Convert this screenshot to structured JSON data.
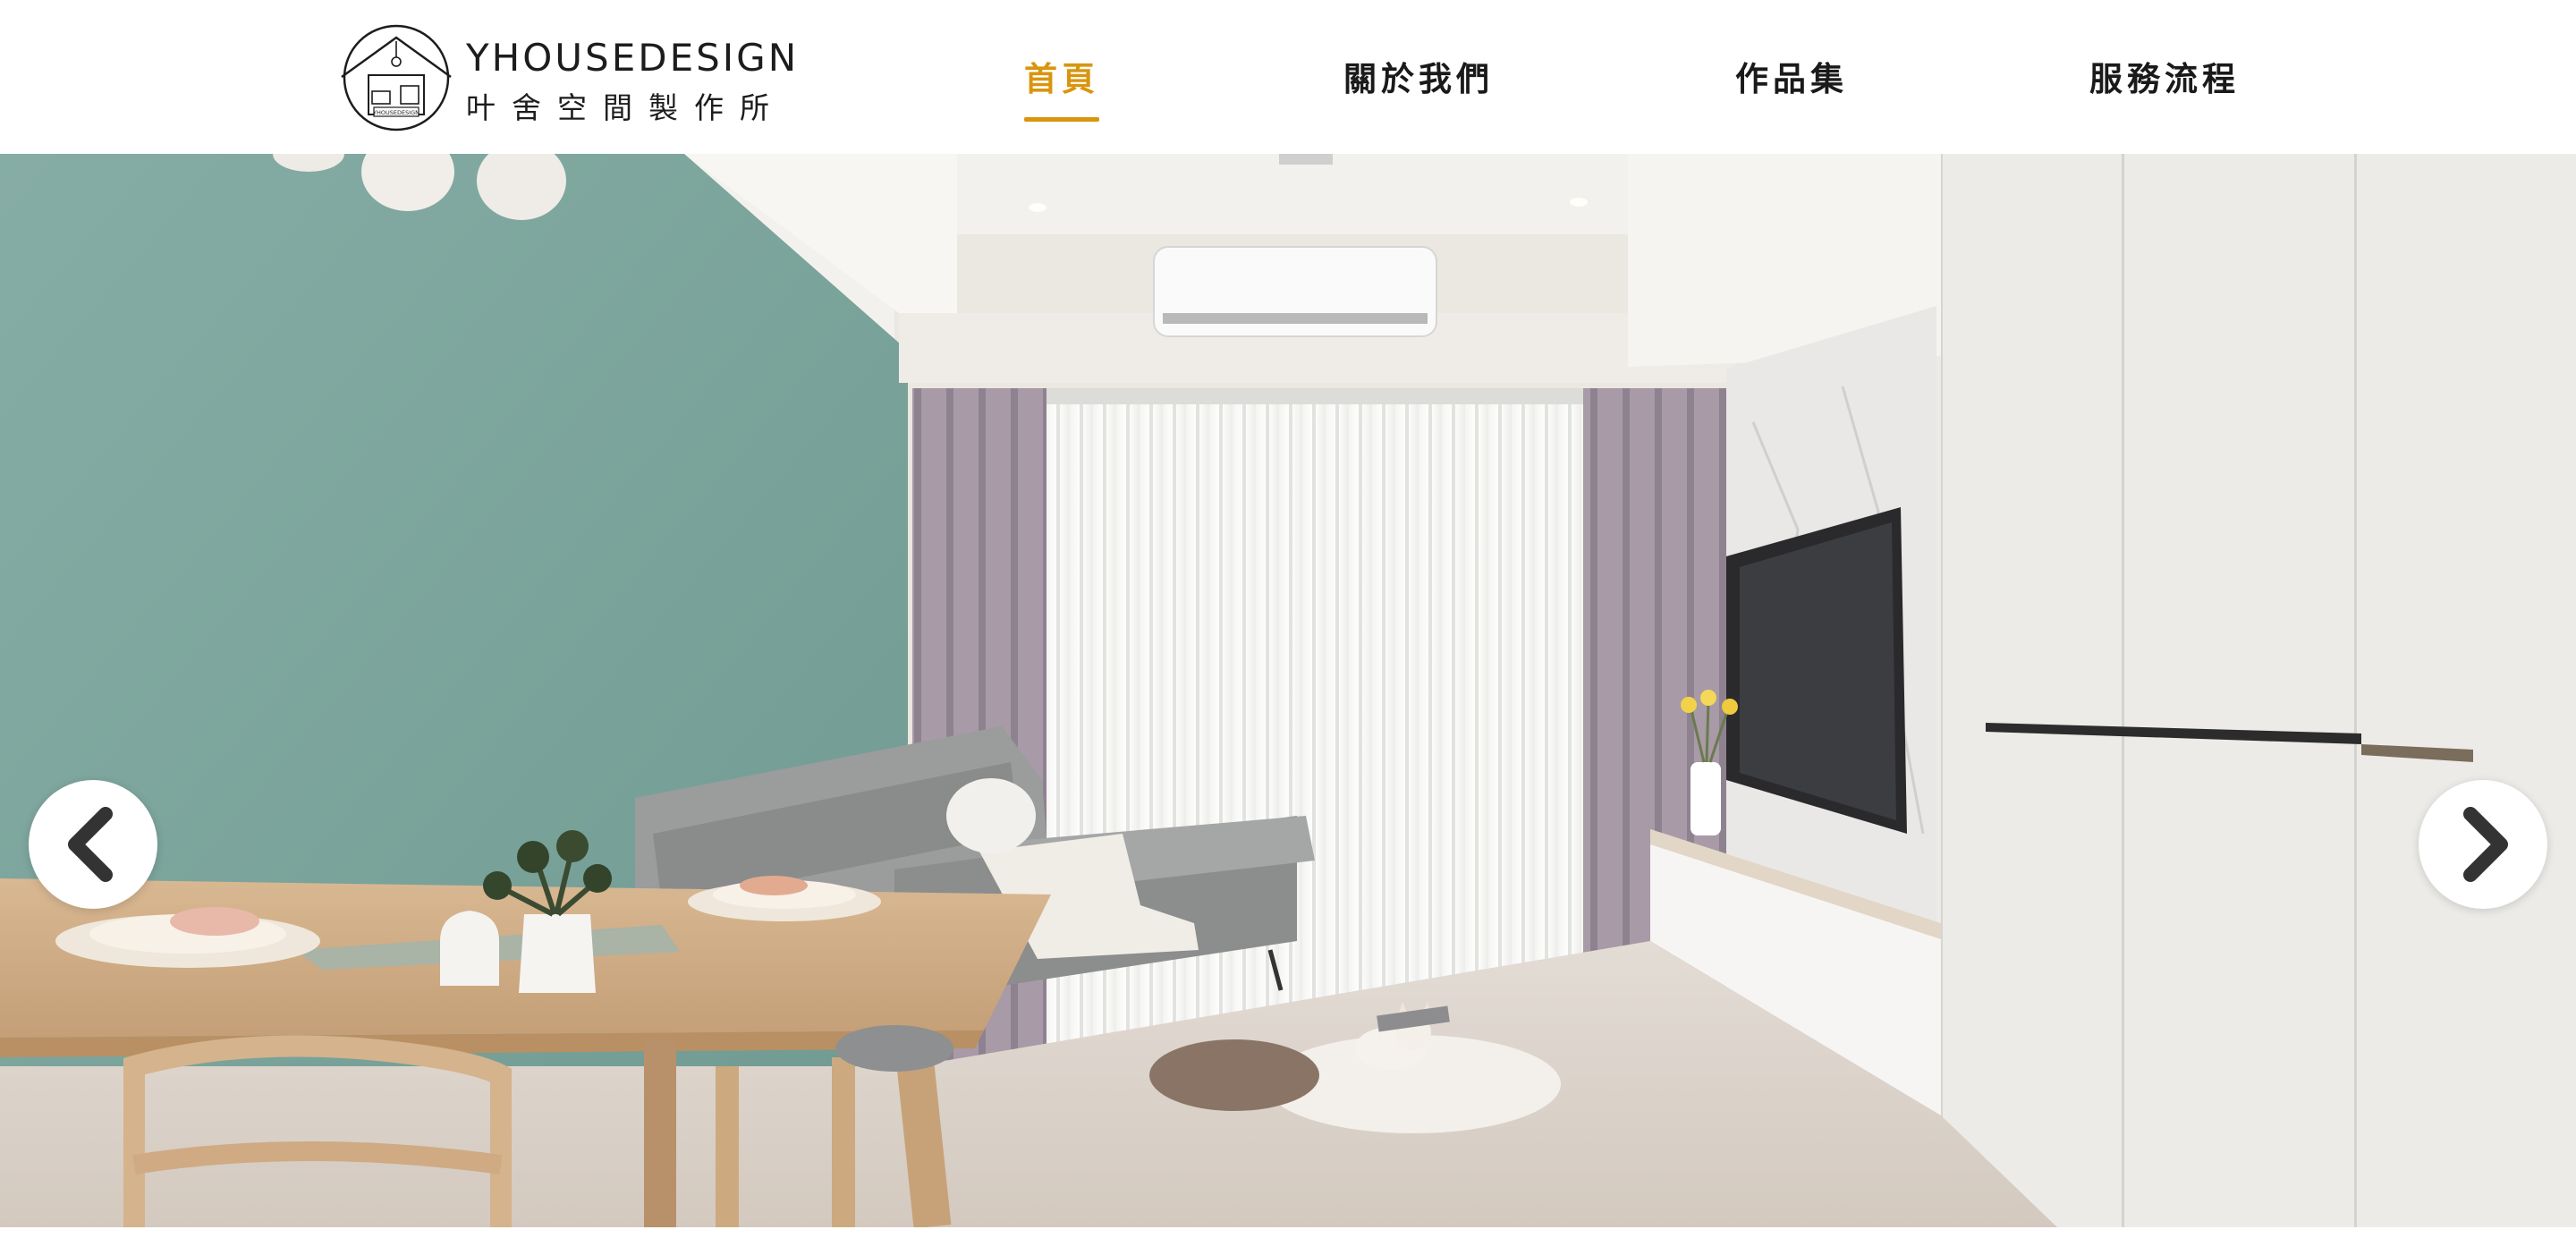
{
  "brand": {
    "name_en": "YHOUSEDESIGN",
    "name_zh": "叶舍空間製作所",
    "logo_badge": "YHOUSEDESIGN"
  },
  "nav": {
    "items": [
      {
        "label": "首頁",
        "active": true
      },
      {
        "label": "關於我們",
        "active": false
      },
      {
        "label": "作品集",
        "active": false
      },
      {
        "label": "服務流程",
        "active": false
      }
    ]
  },
  "hero": {
    "prev_icon": "chevron-left-icon",
    "next_icon": "chevron-right-icon"
  },
  "colors": {
    "accent": "#d9950e",
    "text": "#1a1a1a",
    "wall_green": "#7fa9a0",
    "background": "#ffffff"
  }
}
